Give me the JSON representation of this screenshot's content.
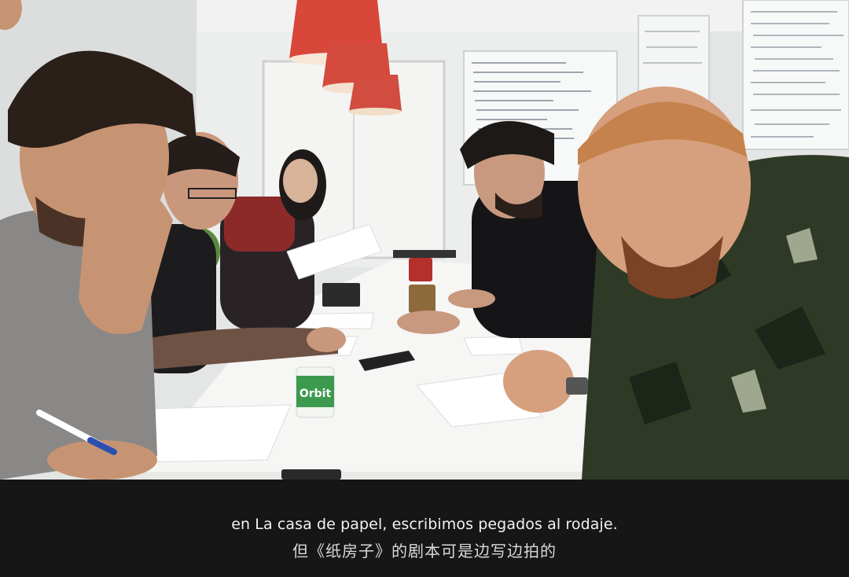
{
  "subtitles": {
    "spanish": "en La casa de papel, escribimos pegados al rodaje.",
    "chinese": "但《纸房子》的剧本可是边写边拍的"
  },
  "scene": {
    "gum_label": "Orbit"
  }
}
